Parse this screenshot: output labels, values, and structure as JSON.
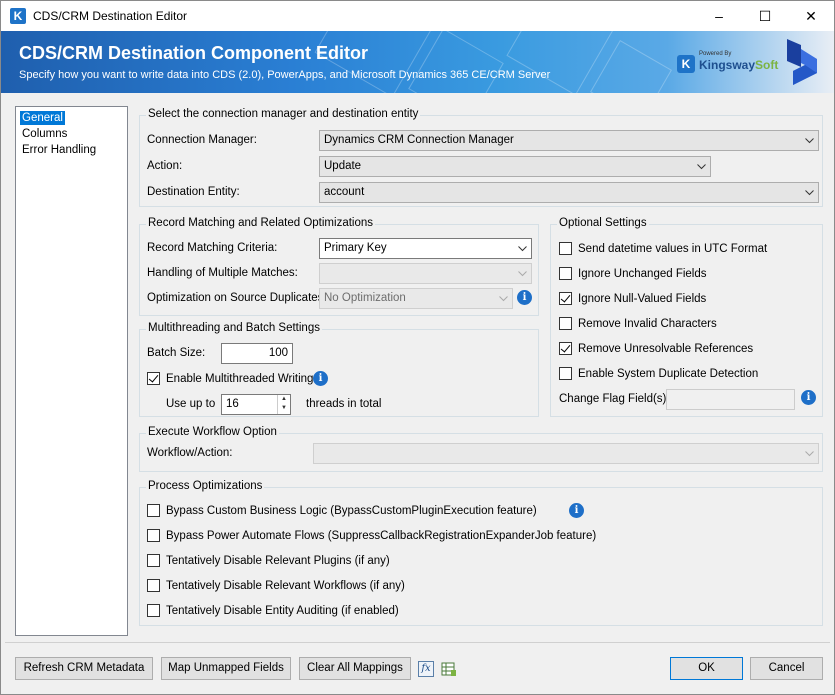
{
  "window": {
    "title": "CDS/CRM Destination Editor",
    "minimize": "–",
    "maximize": "☐",
    "close": "✕"
  },
  "banner": {
    "title": "CDS/CRM Destination Component Editor",
    "subtitle": "Specify how you want to write data into CDS (2.0), PowerApps, and Microsoft Dynamics 365 CE/CRM Server",
    "logo_powered": "Powered By",
    "logo_name_a": "Kingsway",
    "logo_name_b": "Soft"
  },
  "nav": [
    "General",
    "Columns",
    "Error Handling"
  ],
  "connection": {
    "group_title": "Select the connection manager and destination entity",
    "cm_label": "Connection Manager:",
    "cm_value": "Dynamics CRM Connection Manager",
    "action_label": "Action:",
    "action_value": "Update",
    "entity_label": "Destination Entity:",
    "entity_value": "account"
  },
  "matching": {
    "group_title": "Record Matching and Related Optimizations",
    "criteria_label": "Record Matching Criteria:",
    "criteria_value": "Primary Key",
    "multiple_label": "Handling of Multiple Matches:",
    "multiple_value": "",
    "dup_label": "Optimization on Source Duplicates:",
    "dup_value": "No Optimization"
  },
  "multithread": {
    "group_title": "Multithreading and Batch Settings",
    "batch_label": "Batch Size:",
    "batch_value": "100",
    "enable_label": "Enable Multithreaded Writing",
    "enable_checked": true,
    "useupto_label": "Use up to",
    "threads_value": "16",
    "threads_suffix": "threads in total"
  },
  "optional": {
    "group_title": "Optional Settings",
    "items": [
      {
        "label": "Send datetime values in UTC Format",
        "checked": false
      },
      {
        "label": "Ignore Unchanged Fields",
        "checked": false
      },
      {
        "label": "Ignore Null-Valued Fields",
        "checked": true
      },
      {
        "label": "Remove Invalid Characters",
        "checked": false
      },
      {
        "label": "Remove Unresolvable References",
        "checked": true
      },
      {
        "label": "Enable System Duplicate Detection",
        "checked": false
      }
    ],
    "change_flag_label": "Change Flag Field(s):",
    "change_flag_value": ""
  },
  "workflow": {
    "group_title": "Execute Workflow Option",
    "label": "Workflow/Action:",
    "value": ""
  },
  "process": {
    "group_title": "Process Optimizations",
    "items": [
      {
        "label": "Bypass Custom Business Logic (BypassCustomPluginExecution feature)",
        "checked": false
      },
      {
        "label": "Bypass Power Automate Flows (SuppressCallbackRegistrationExpanderJob feature)",
        "checked": false
      },
      {
        "label": "Tentatively Disable Relevant Plugins (if any)",
        "checked": false
      },
      {
        "label": "Tentatively Disable Relevant Workflows (if any)",
        "checked": false
      },
      {
        "label": "Tentatively Disable Entity Auditing (if enabled)",
        "checked": false
      }
    ]
  },
  "footer": {
    "refresh": "Refresh CRM Metadata",
    "map": "Map Unmapped Fields",
    "clear": "Clear All Mappings",
    "fx": "fx",
    "ok": "OK",
    "cancel": "Cancel"
  },
  "info_glyph": "i"
}
